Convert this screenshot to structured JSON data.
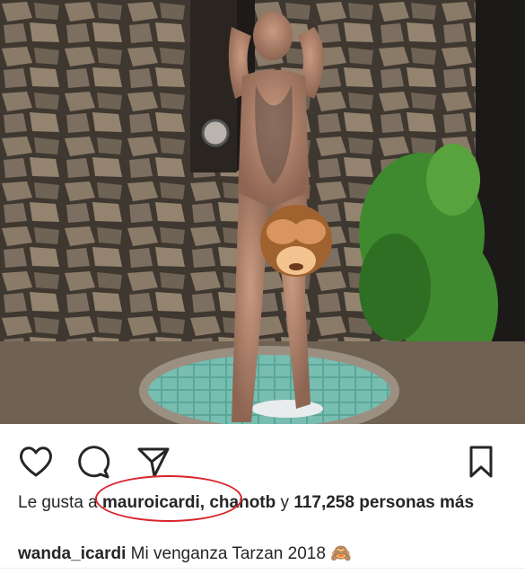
{
  "post": {
    "photo_alt": "photo",
    "overlay_emoji": "🙈"
  },
  "actions": {
    "like_icon": "heart-icon",
    "comment_icon": "comment-icon",
    "share_icon": "paper-plane-icon",
    "save_icon": "bookmark-icon"
  },
  "likes": {
    "prefix": "Le gusta a ",
    "user1": "mauroicardi",
    "sep": ", ",
    "user2": "chanotb",
    "middle": " y ",
    "count": "117,258 personas más"
  },
  "caption": {
    "username": "wanda_icardi",
    "text": " Mi venganza Tarzan 2018 ",
    "emoji": "🙈"
  },
  "colors": {
    "annotation": "#d8262b",
    "text": "#262626"
  }
}
